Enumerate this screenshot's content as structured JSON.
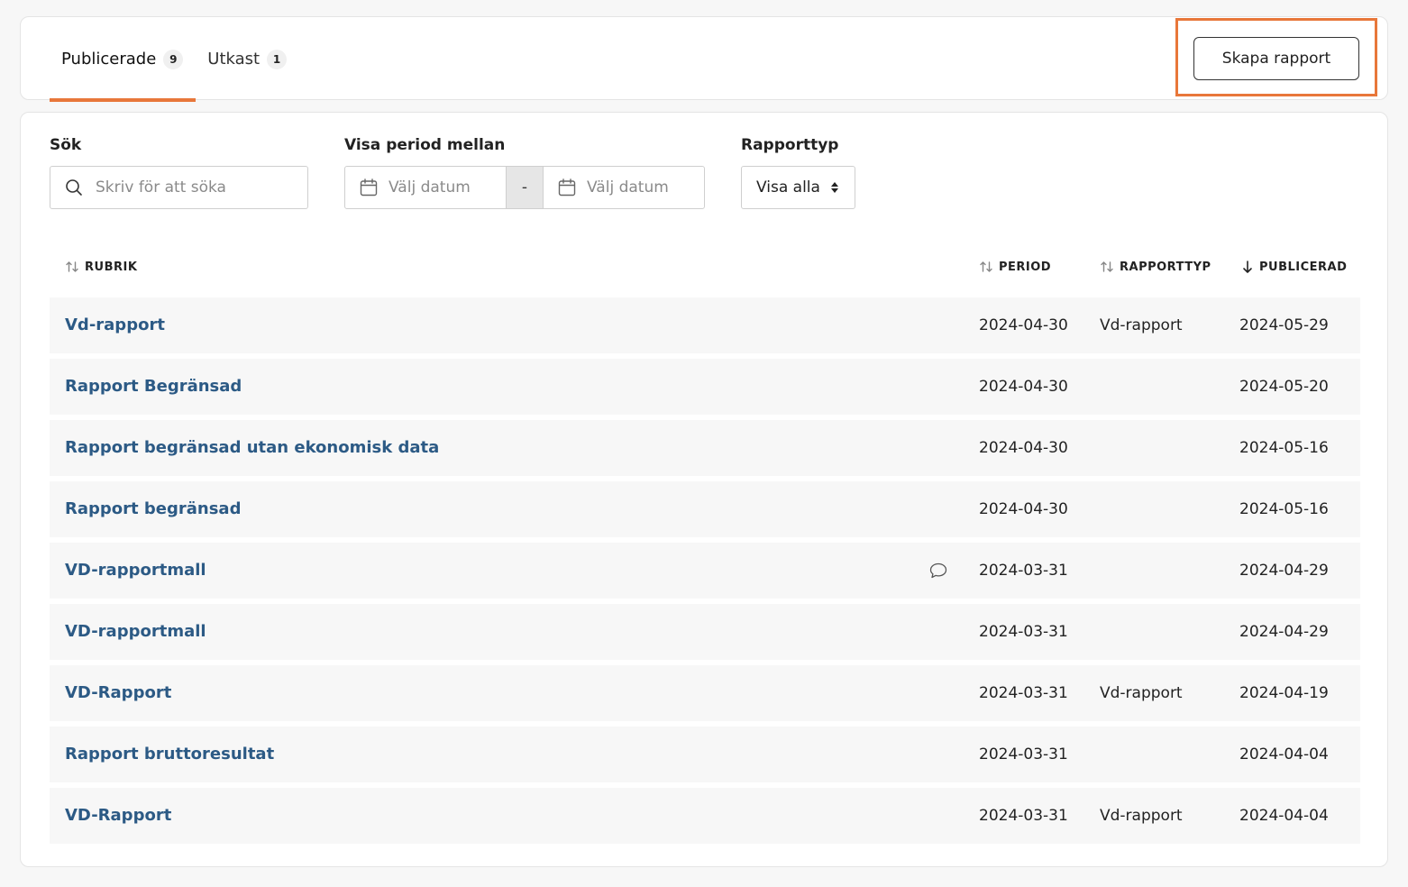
{
  "tabs": [
    {
      "label": "Publicerade",
      "count": "9",
      "active": true
    },
    {
      "label": "Utkast",
      "count": "1",
      "active": false
    }
  ],
  "create_button_label": "Skapa rapport",
  "accent_color": "#e8773a",
  "link_color": "#2c5a85",
  "filters": {
    "search": {
      "label": "Sök",
      "placeholder": "Skriv för att söka"
    },
    "period": {
      "label": "Visa period mellan",
      "from_placeholder": "Välj datum",
      "separator": "-",
      "to_placeholder": "Välj datum"
    },
    "report_type": {
      "label": "Rapporttyp",
      "selected": "Visa alla"
    }
  },
  "columns": {
    "rubrik": "RUBRIK",
    "period": "PERIOD",
    "rapporttyp": "RAPPORTTYP",
    "publicerad": "PUBLICERAD"
  },
  "rows": [
    {
      "title": "Vd-rapport",
      "period": "2024-04-30",
      "type": "Vd-rapport",
      "published": "2024-05-29",
      "comment": false
    },
    {
      "title": "Rapport Begränsad",
      "period": "2024-04-30",
      "type": "",
      "published": "2024-05-20",
      "comment": false
    },
    {
      "title": "Rapport begränsad utan ekonomisk data",
      "period": "2024-04-30",
      "type": "",
      "published": "2024-05-16",
      "comment": false
    },
    {
      "title": "Rapport begränsad",
      "period": "2024-04-30",
      "type": "",
      "published": "2024-05-16",
      "comment": false
    },
    {
      "title": "VD-rapportmall",
      "period": "2024-03-31",
      "type": "",
      "published": "2024-04-29",
      "comment": true
    },
    {
      "title": "VD-rapportmall",
      "period": "2024-03-31",
      "type": "",
      "published": "2024-04-29",
      "comment": false
    },
    {
      "title": "VD-Rapport",
      "period": "2024-03-31",
      "type": "Vd-rapport",
      "published": "2024-04-19",
      "comment": false
    },
    {
      "title": "Rapport bruttoresultat",
      "period": "2024-03-31",
      "type": "",
      "published": "2024-04-04",
      "comment": false
    },
    {
      "title": "VD-Rapport",
      "period": "2024-03-31",
      "type": "Vd-rapport",
      "published": "2024-04-04",
      "comment": false
    }
  ]
}
